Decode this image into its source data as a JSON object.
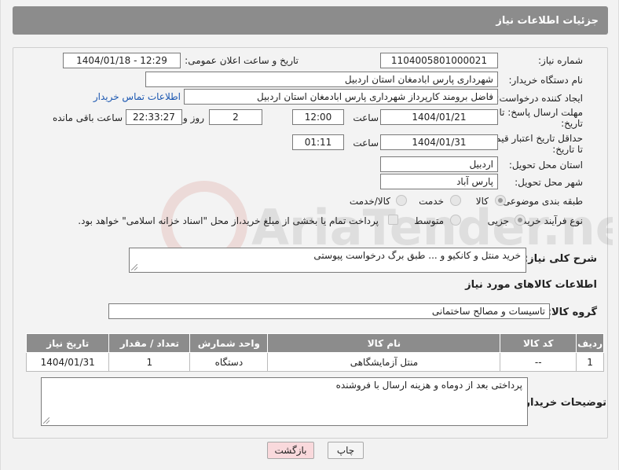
{
  "header": {
    "title": "جزئیات اطلاعات نیاز"
  },
  "form": {
    "need_number_label": "شماره نیاز:",
    "need_number": "1104005801000021",
    "announce_datetime_label": "تاریخ و ساعت اعلان عمومی:",
    "announce_datetime": "1404/01/18 - 12:29",
    "buyer_org_label": "نام دستگاه خریدار:",
    "buyer_org": "شهرداری پارس ابادمغان استان اردبیل",
    "requester_label": "ایجاد کننده درخواست:",
    "requester": "فاضل برومند کارپرداز شهرداری پارس ابادمغان استان اردبیل",
    "buyer_contact_link": "اطلاعات تماس خریدار",
    "reply_deadline_label": "مهلت ارسال پاسخ: تا تاریخ:",
    "reply_date": "1404/01/21",
    "time_label": "ساعت",
    "reply_time": "12:00",
    "days_value": "2",
    "days_label": "روز و",
    "remaining_time": "22:33:27",
    "remaining_label": "ساعت باقی مانده",
    "price_validity_label": "حداقل تاریخ اعتبار قیمت: تا تاریخ:",
    "validity_date": "1404/01/31",
    "validity_time": "01:11",
    "province_label": "استان محل تحویل:",
    "province": "اردبیل",
    "city_label": "شهر محل تحویل:",
    "city": "پارس آباد",
    "category_label": "طبقه بندی موضوعی:",
    "category_options": [
      "کالا",
      "خدمت",
      "کالا/خدمت"
    ],
    "process_label": "نوع فرآیند خرید :",
    "process_options": [
      "جزیی",
      "متوسط"
    ],
    "payment_note": "پرداخت تمام یا بخشی از مبلغ خرید،از محل \"اسناد خزانه اسلامی\" خواهد بود.",
    "description_label": "شرح کلی نیاز:",
    "description": "خرید منتل و کانکیو و ... طبق برگ درخواست پیوستی",
    "goods_info_title": "اطلاعات کالاهای مورد نیاز",
    "goods_group_label": "گروه کالا:",
    "goods_group": "تاسیسات و مصالح ساختمانی",
    "buyer_notes_label": "توضیحات خریدار:",
    "buyer_notes": "پرداختی بعد از دوماه و هزینه ارسال با فروشنده"
  },
  "table": {
    "headers": [
      "ردیف",
      "کد کالا",
      "نام کالا",
      "واحد شمارش",
      "تعداد / مقدار",
      "تاریخ نیاز"
    ],
    "rows": [
      [
        "1",
        "--",
        "منتل آزمایشگاهی",
        "دستگاه",
        "1",
        "1404/01/31"
      ]
    ]
  },
  "buttons": {
    "print": "چاپ",
    "back": "بازگشت"
  },
  "watermark": {
    "text": "AriaTender.net"
  }
}
